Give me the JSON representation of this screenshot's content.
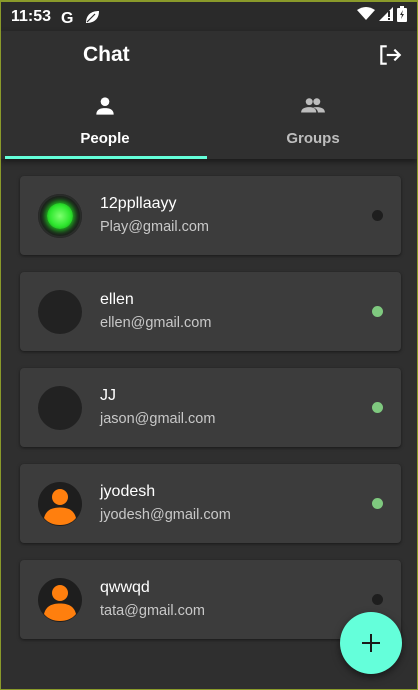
{
  "status_bar": {
    "time": "11:53",
    "icons": [
      "google-g-icon",
      "leaf-icon",
      "wifi-icon",
      "signal-icon",
      "battery-icon"
    ]
  },
  "app_bar": {
    "title": "Chat",
    "action_icon": "logout-icon"
  },
  "tabs": [
    {
      "label": "People",
      "icon": "person-icon",
      "active": true
    },
    {
      "label": "Groups",
      "icon": "group-icon",
      "active": false
    }
  ],
  "contacts": [
    {
      "name": "12ppllaayy",
      "email": "Play@gmail.com",
      "avatar": "green-orb",
      "online": false
    },
    {
      "name": "ellen",
      "email": "ellen@gmail.com",
      "avatar": "blank",
      "online": true
    },
    {
      "name": "JJ",
      "email": "jason@gmail.com",
      "avatar": "blank",
      "online": true
    },
    {
      "name": "jyodesh",
      "email": "jyodesh@gmail.com",
      "avatar": "orange-person",
      "online": true
    },
    {
      "name": "qwwqd",
      "email": "tata@gmail.com",
      "avatar": "orange-person",
      "online": false
    }
  ],
  "fab": {
    "icon": "plus-icon"
  },
  "colors": {
    "accent": "#64ffda",
    "online": "#7fc97f",
    "offline": "#1e1e1e",
    "avatar_orange": "#ff7f0e"
  }
}
